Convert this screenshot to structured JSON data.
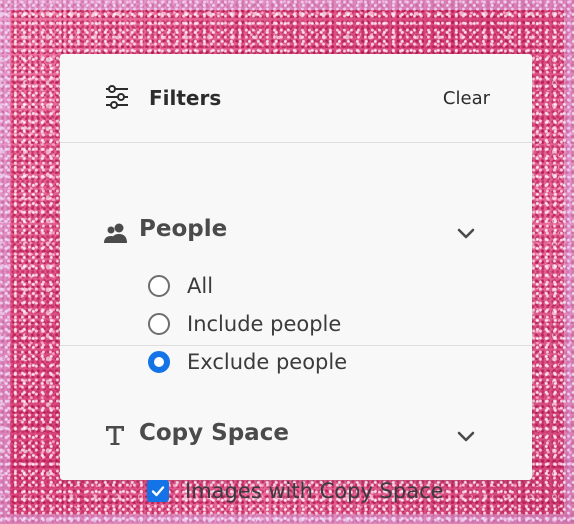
{
  "panel": {
    "title": "Filters",
    "clear_label": "Clear",
    "title_icon": "sliders-icon"
  },
  "sections": {
    "people": {
      "title": "People",
      "icon": "people-icon",
      "expand_icon": "chevron-down-icon",
      "options": [
        {
          "label": "All",
          "selected": false
        },
        {
          "label": "Include people",
          "selected": false
        },
        {
          "label": "Exclude people",
          "selected": true
        }
      ]
    },
    "copy_space": {
      "title": "Copy Space",
      "icon": "text-type-icon",
      "expand_icon": "chevron-down-icon",
      "checkbox": {
        "label": "Images with Copy Space",
        "checked": true
      }
    }
  },
  "colors": {
    "accent": "#1473e6",
    "panel_background": "#f8f8f8",
    "divider": "#dedede",
    "text_primary": "#2c2c2c",
    "text_section": "#4b4b4b",
    "background_glitter": "#e24f86"
  }
}
